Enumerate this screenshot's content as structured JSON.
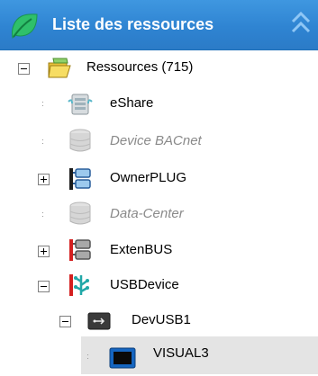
{
  "panel": {
    "title": "Liste des ressources",
    "header_color": "#2f84d2",
    "header_icon": "leaf-icon",
    "collapse_icon": "double-chevron-up-icon"
  },
  "tree": {
    "root": {
      "label": "Ressources (715)",
      "icon": "folder-icon",
      "expanded": true
    },
    "items": [
      {
        "label": "eShare",
        "icon": "server-icon",
        "state": "normal",
        "has_children": false
      },
      {
        "label": "Device BACnet",
        "icon": "database-icon",
        "state": "disabled",
        "has_children": false
      },
      {
        "label": "OwnerPLUG",
        "icon": "network-icon",
        "state": "normal",
        "has_children": true,
        "expanded": false
      },
      {
        "label": "Data-Center",
        "icon": "database-icon",
        "state": "disabled",
        "has_children": false
      },
      {
        "label": "ExtenBUS",
        "icon": "bus-module-icon",
        "state": "normal",
        "has_children": true,
        "expanded": false
      },
      {
        "label": "USBDevice",
        "icon": "usb-tree-icon",
        "state": "normal",
        "has_children": true,
        "expanded": true
      },
      {
        "label": "DevUSB1",
        "icon": "usb-device-icon",
        "state": "normal",
        "has_children": true,
        "expanded": true
      },
      {
        "label": "VISUAL3",
        "icon": "monitor-icon",
        "state": "selected",
        "has_children": false
      }
    ]
  },
  "colors": {
    "disabled_text": "#8a8a8a",
    "selection_bg": "#e4e4e4"
  }
}
